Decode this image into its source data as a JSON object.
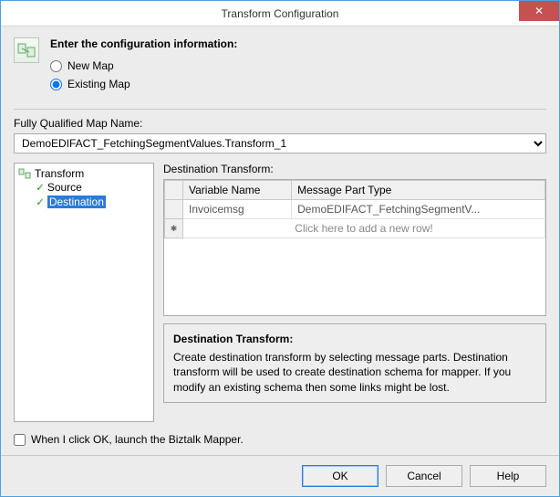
{
  "window": {
    "title": "Transform Configuration",
    "close_glyph": "✕"
  },
  "top": {
    "prompt": "Enter the configuration information:",
    "radio_new": "New Map",
    "radio_existing": "Existing Map",
    "selected": "existing"
  },
  "map": {
    "label": "Fully Qualified Map Name:",
    "value": "DemoEDIFACT_FetchingSegmentValues.Transform_1"
  },
  "tree": {
    "root": "Transform",
    "items": [
      {
        "label": "Source",
        "selected": false
      },
      {
        "label": "Destination",
        "selected": true
      }
    ]
  },
  "right": {
    "title": "Destination Transform:",
    "columns": [
      "Variable Name",
      "Message Part Type"
    ],
    "rows": [
      {
        "variable": "Invoicemsg",
        "type": "DemoEDIFACT_FetchingSegmentV..."
      }
    ],
    "add_row_placeholder": "Click here to add a new row!",
    "star_glyph": "✱"
  },
  "description": {
    "heading": "Destination Transform:",
    "body": "Create destination transform by selecting message parts. Destination transform will be used to create destination schema for mapper. If you modify an existing schema then some links might be lost."
  },
  "footer": {
    "checkbox_label": "When I click OK, launch the Biztalk Mapper."
  },
  "buttons": {
    "ok": "OK",
    "cancel": "Cancel",
    "help": "Help"
  }
}
